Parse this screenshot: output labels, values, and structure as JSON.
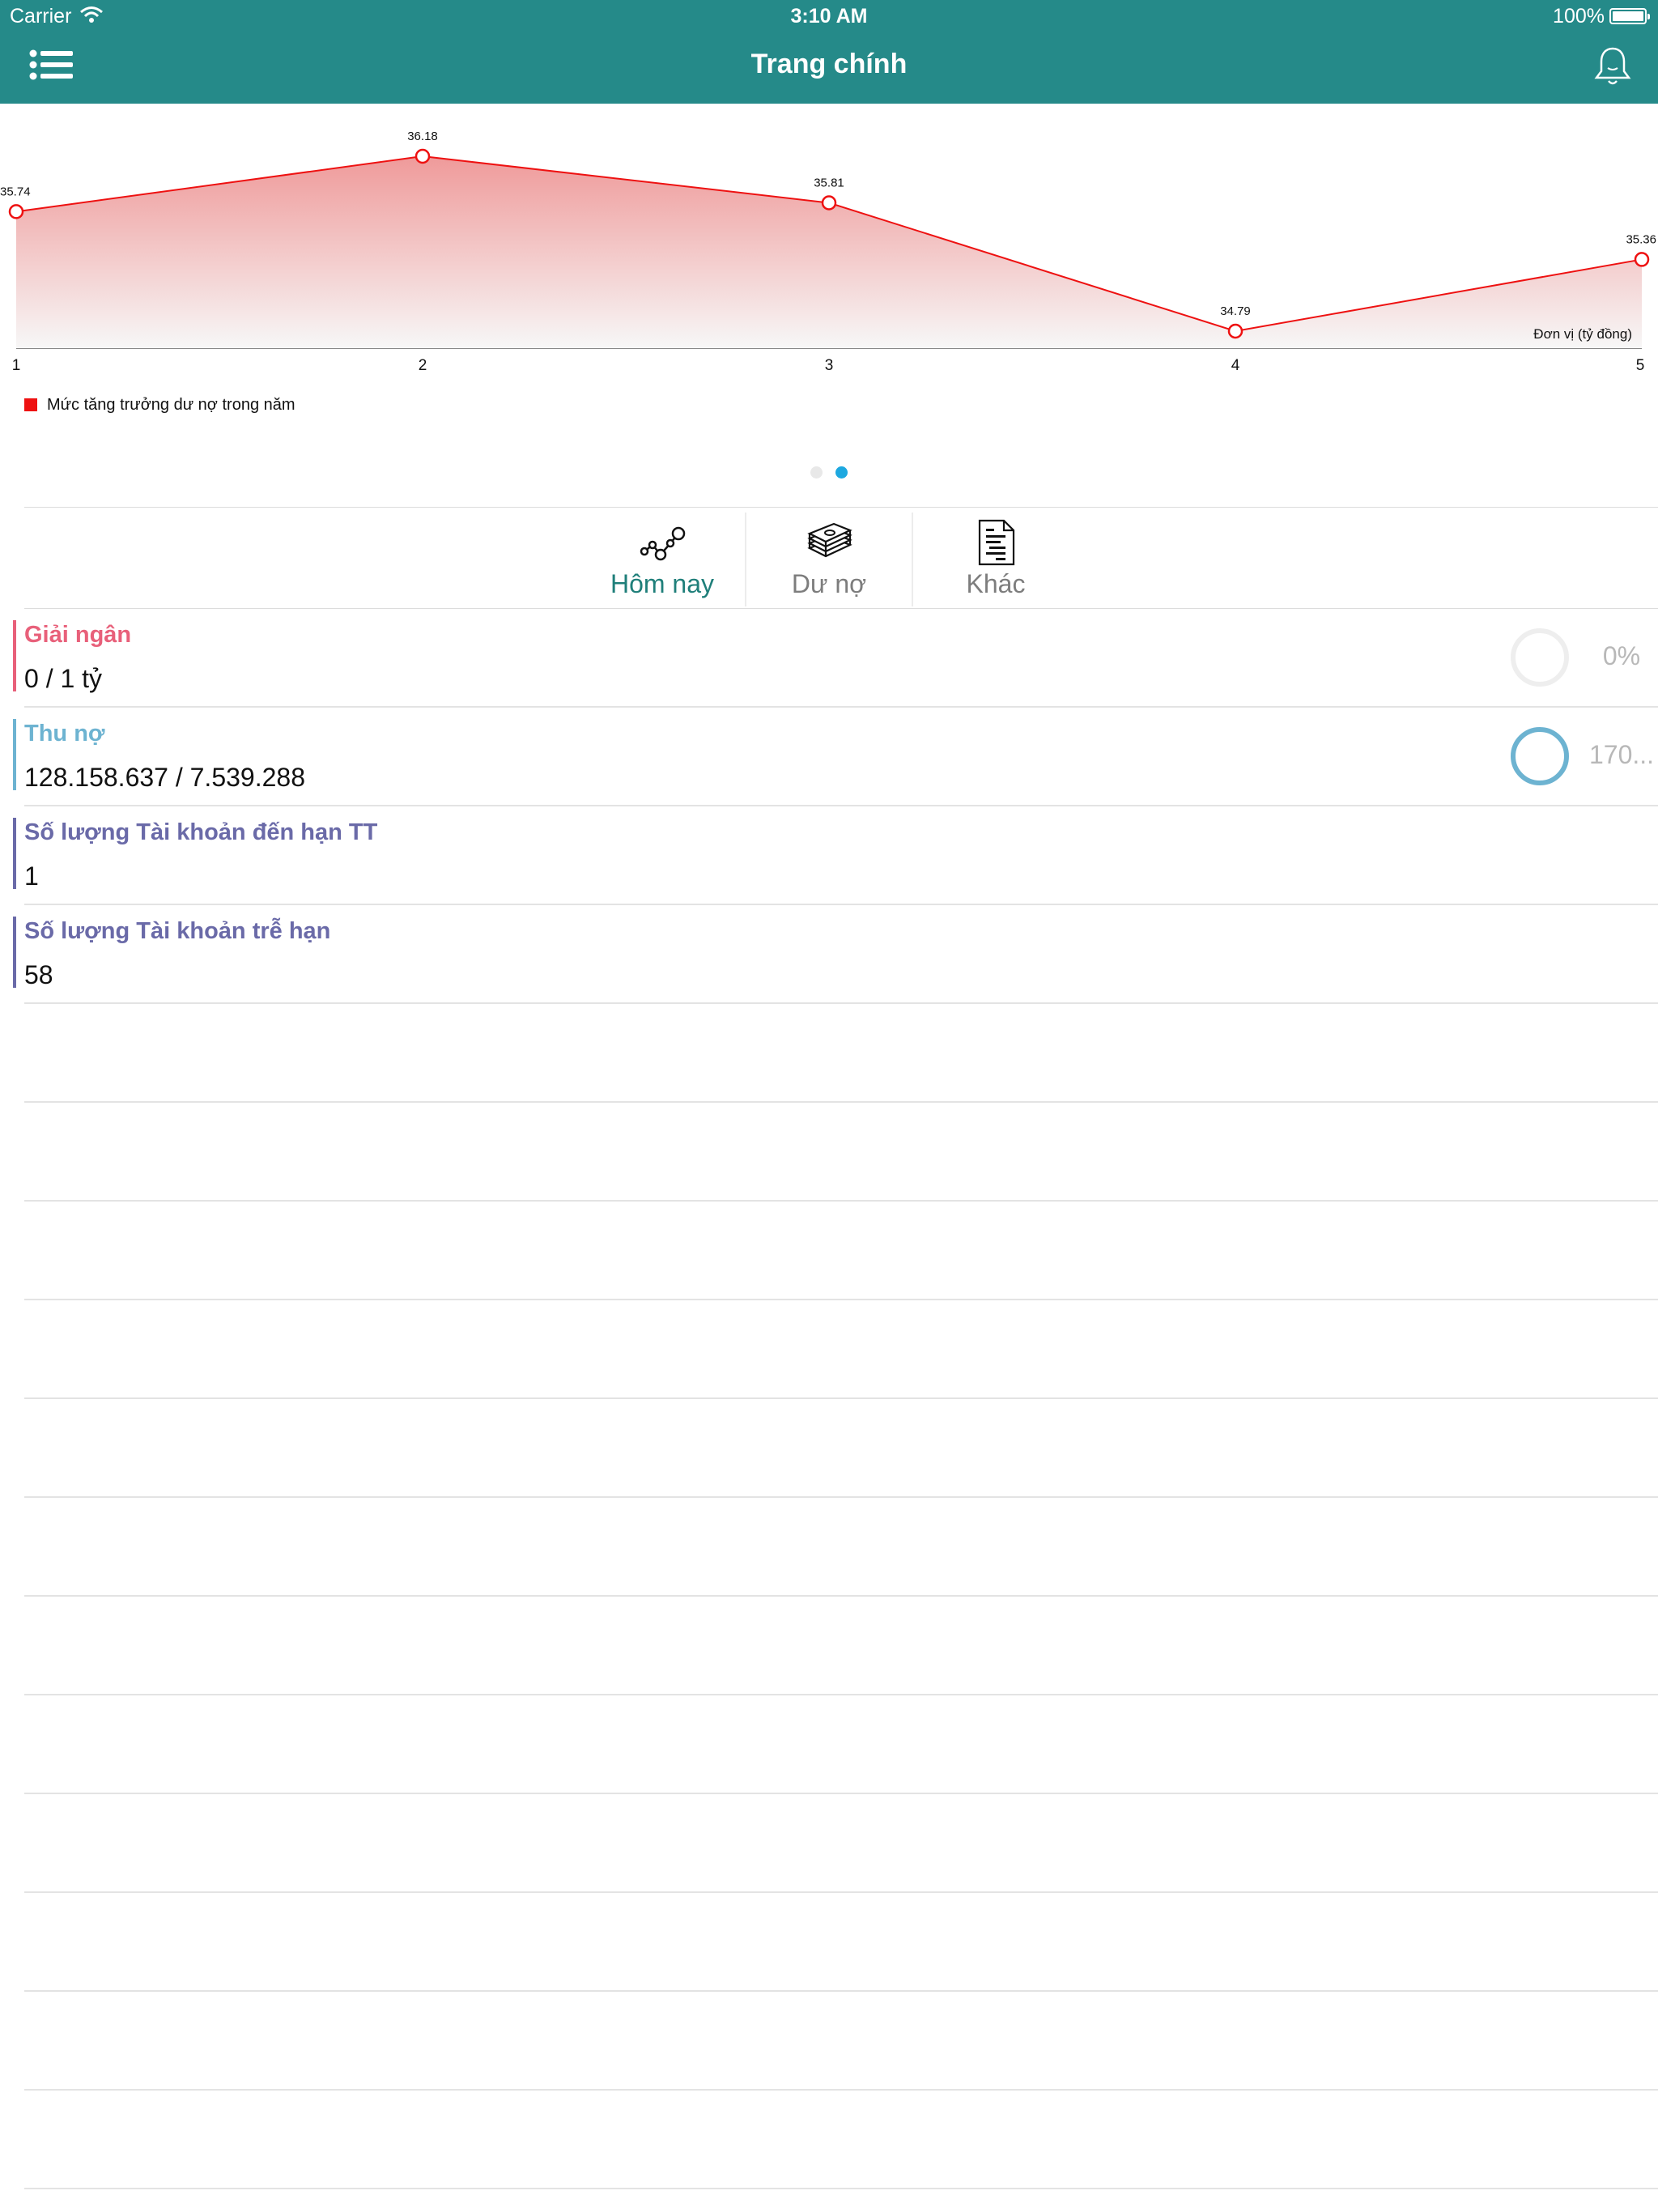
{
  "status_bar": {
    "carrier": "Carrier",
    "time": "3:10 AM",
    "battery": "100%"
  },
  "nav": {
    "title": "Trang chính",
    "menu_icon": "list-icon",
    "bell_icon": "bell-icon"
  },
  "colors": {
    "header": "#258a89",
    "line": "#ee1111",
    "active_tab": "#1f7f7a",
    "dot_active": "#1da8e0"
  },
  "chart_data": {
    "type": "area",
    "x": [
      1,
      2,
      3,
      4,
      5
    ],
    "values": [
      35.74,
      36.18,
      35.81,
      34.79,
      35.36
    ],
    "series": [
      {
        "name": "Mức tăng trưởng dư nợ trong năm",
        "values": [
          35.74,
          36.18,
          35.81,
          34.79,
          35.36
        ]
      }
    ],
    "unit_note": "Đơn vị (tỷ đồng)",
    "xticks": [
      "1",
      "2",
      "3",
      "4",
      "5"
    ],
    "legend_position": "bottom-left",
    "grid": false
  },
  "pager": {
    "count": 2,
    "active": 1
  },
  "tabs": [
    {
      "label": "Hôm nay",
      "icon": "network-graph-icon",
      "active": true
    },
    {
      "label": "Dư nợ",
      "icon": "money-stack-icon",
      "active": false
    },
    {
      "label": "Khác",
      "icon": "document-icon",
      "active": false
    }
  ],
  "rows": [
    {
      "title": "Giải ngân",
      "value": "0 / 1 tỷ",
      "color": "#e8607a",
      "pct": "0%",
      "ring_color": "#eeeeee"
    },
    {
      "title": "Thu nợ",
      "value": "128.158.637 / 7.539.288",
      "color": "#6db3d1",
      "pct": "170...",
      "ring_color": "#6db3d1"
    },
    {
      "title": "Số lượng Tài khoản đến hạn TT",
      "value": "1",
      "color": "#6a6aa8"
    },
    {
      "title": "Số lượng Tài khoản trễ hạn",
      "value": "58",
      "color": "#6a6aa8"
    }
  ]
}
